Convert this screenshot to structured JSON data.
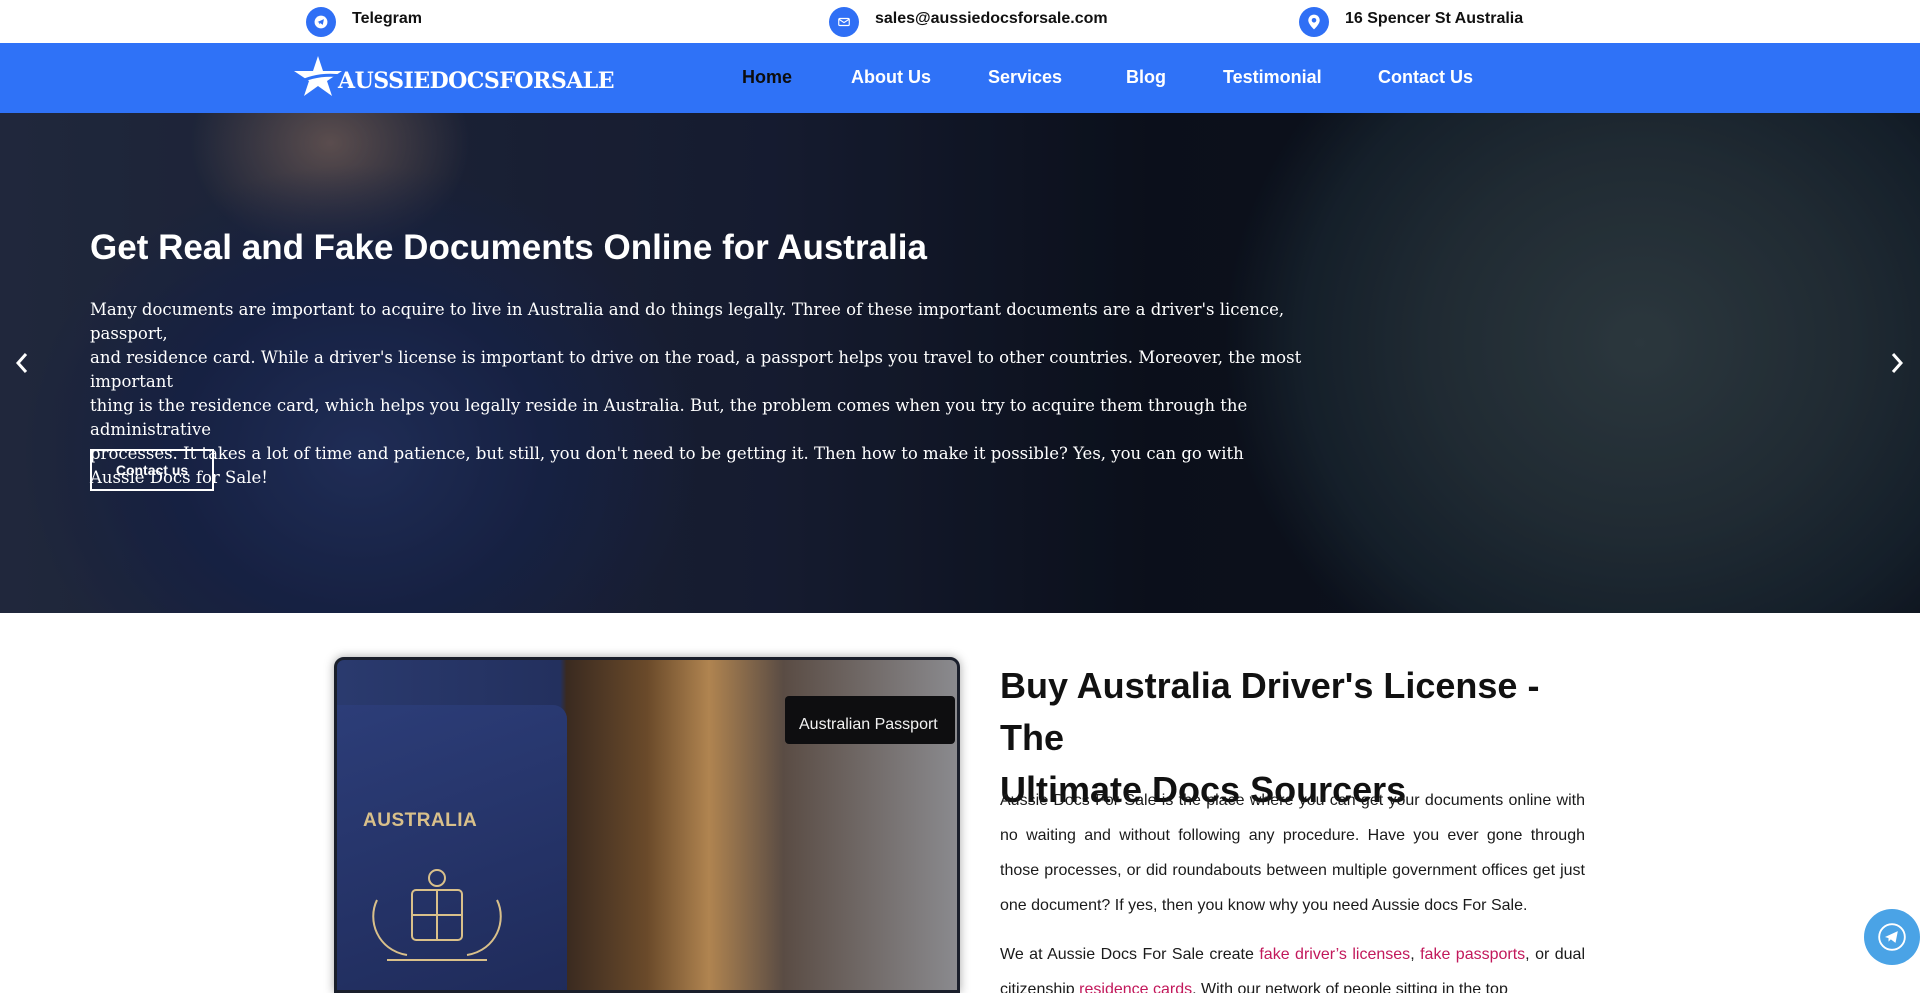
{
  "topbar": {
    "telegram": "Telegram",
    "email": "sales@aussiedocsforsale.com",
    "address": "16 Spencer St Australia",
    "icons": [
      "telegram-icon",
      "envelope-icon",
      "location-pin-icon"
    ],
    "accent": "#2f6ff5"
  },
  "nav": {
    "logo_text": "AUSSIEDOCSFORSALE",
    "items": [
      {
        "label": "Home",
        "active": true
      },
      {
        "label": "About Us",
        "active": false
      },
      {
        "label": "Services",
        "active": false
      },
      {
        "label": "Blog",
        "active": false
      },
      {
        "label": "Testimonial",
        "active": false
      },
      {
        "label": "Contact Us",
        "active": false
      }
    ],
    "background": "#2f72f7"
  },
  "hero": {
    "title": "Get Real and Fake Documents Online for Australia",
    "text_lines": [
      "Many documents are important to acquire to live in Australia and do things legally. Three of these important documents are a driver's licence, passport,",
      "and residence card. While a driver's license is important to drive on the road, a passport helps you travel to other countries. Moreover, the most important",
      "thing is the residence card, which helps you legally reside in Australia. But, the problem comes when you try to acquire them through the administrative",
      "processes. It takes a lot of time and patience, but still, you don't need to be getting it. Then how to make it possible? Yes, you can go with",
      "Aussie Docs for Sale!"
    ],
    "button": "Contact us",
    "prev_icon": "chevron-left-icon",
    "next_icon": "chevron-right-icon"
  },
  "section": {
    "image_texts": {
      "passport_word": "AUSTRALIA",
      "sign": "Australian Passport"
    },
    "title_line1": "Buy Australia Driver's License - The",
    "title_line2": "Ultimate Docs Sourcers",
    "para1": "Aussie Docs For Sale is the place where you can get your documents online with no waiting and without following any procedure. Have you ever gone through those processes, or did roundabouts between multiple government offices get just one document? If yes, then you know why you need Aussie docs For Sale.",
    "para2": {
      "t1": "We at Aussie Docs For Sale create ",
      "link1": "fake driver’s licenses",
      "t2": ", ",
      "link2": "fake passports",
      "t3": ", or dual citizenship ",
      "link3": "residence cards",
      "t4": ". With our network of people sitting in the top"
    },
    "link_color": "#c2185b"
  },
  "floating": {
    "icon": "telegram-icon",
    "color": "#4aa3e6"
  }
}
